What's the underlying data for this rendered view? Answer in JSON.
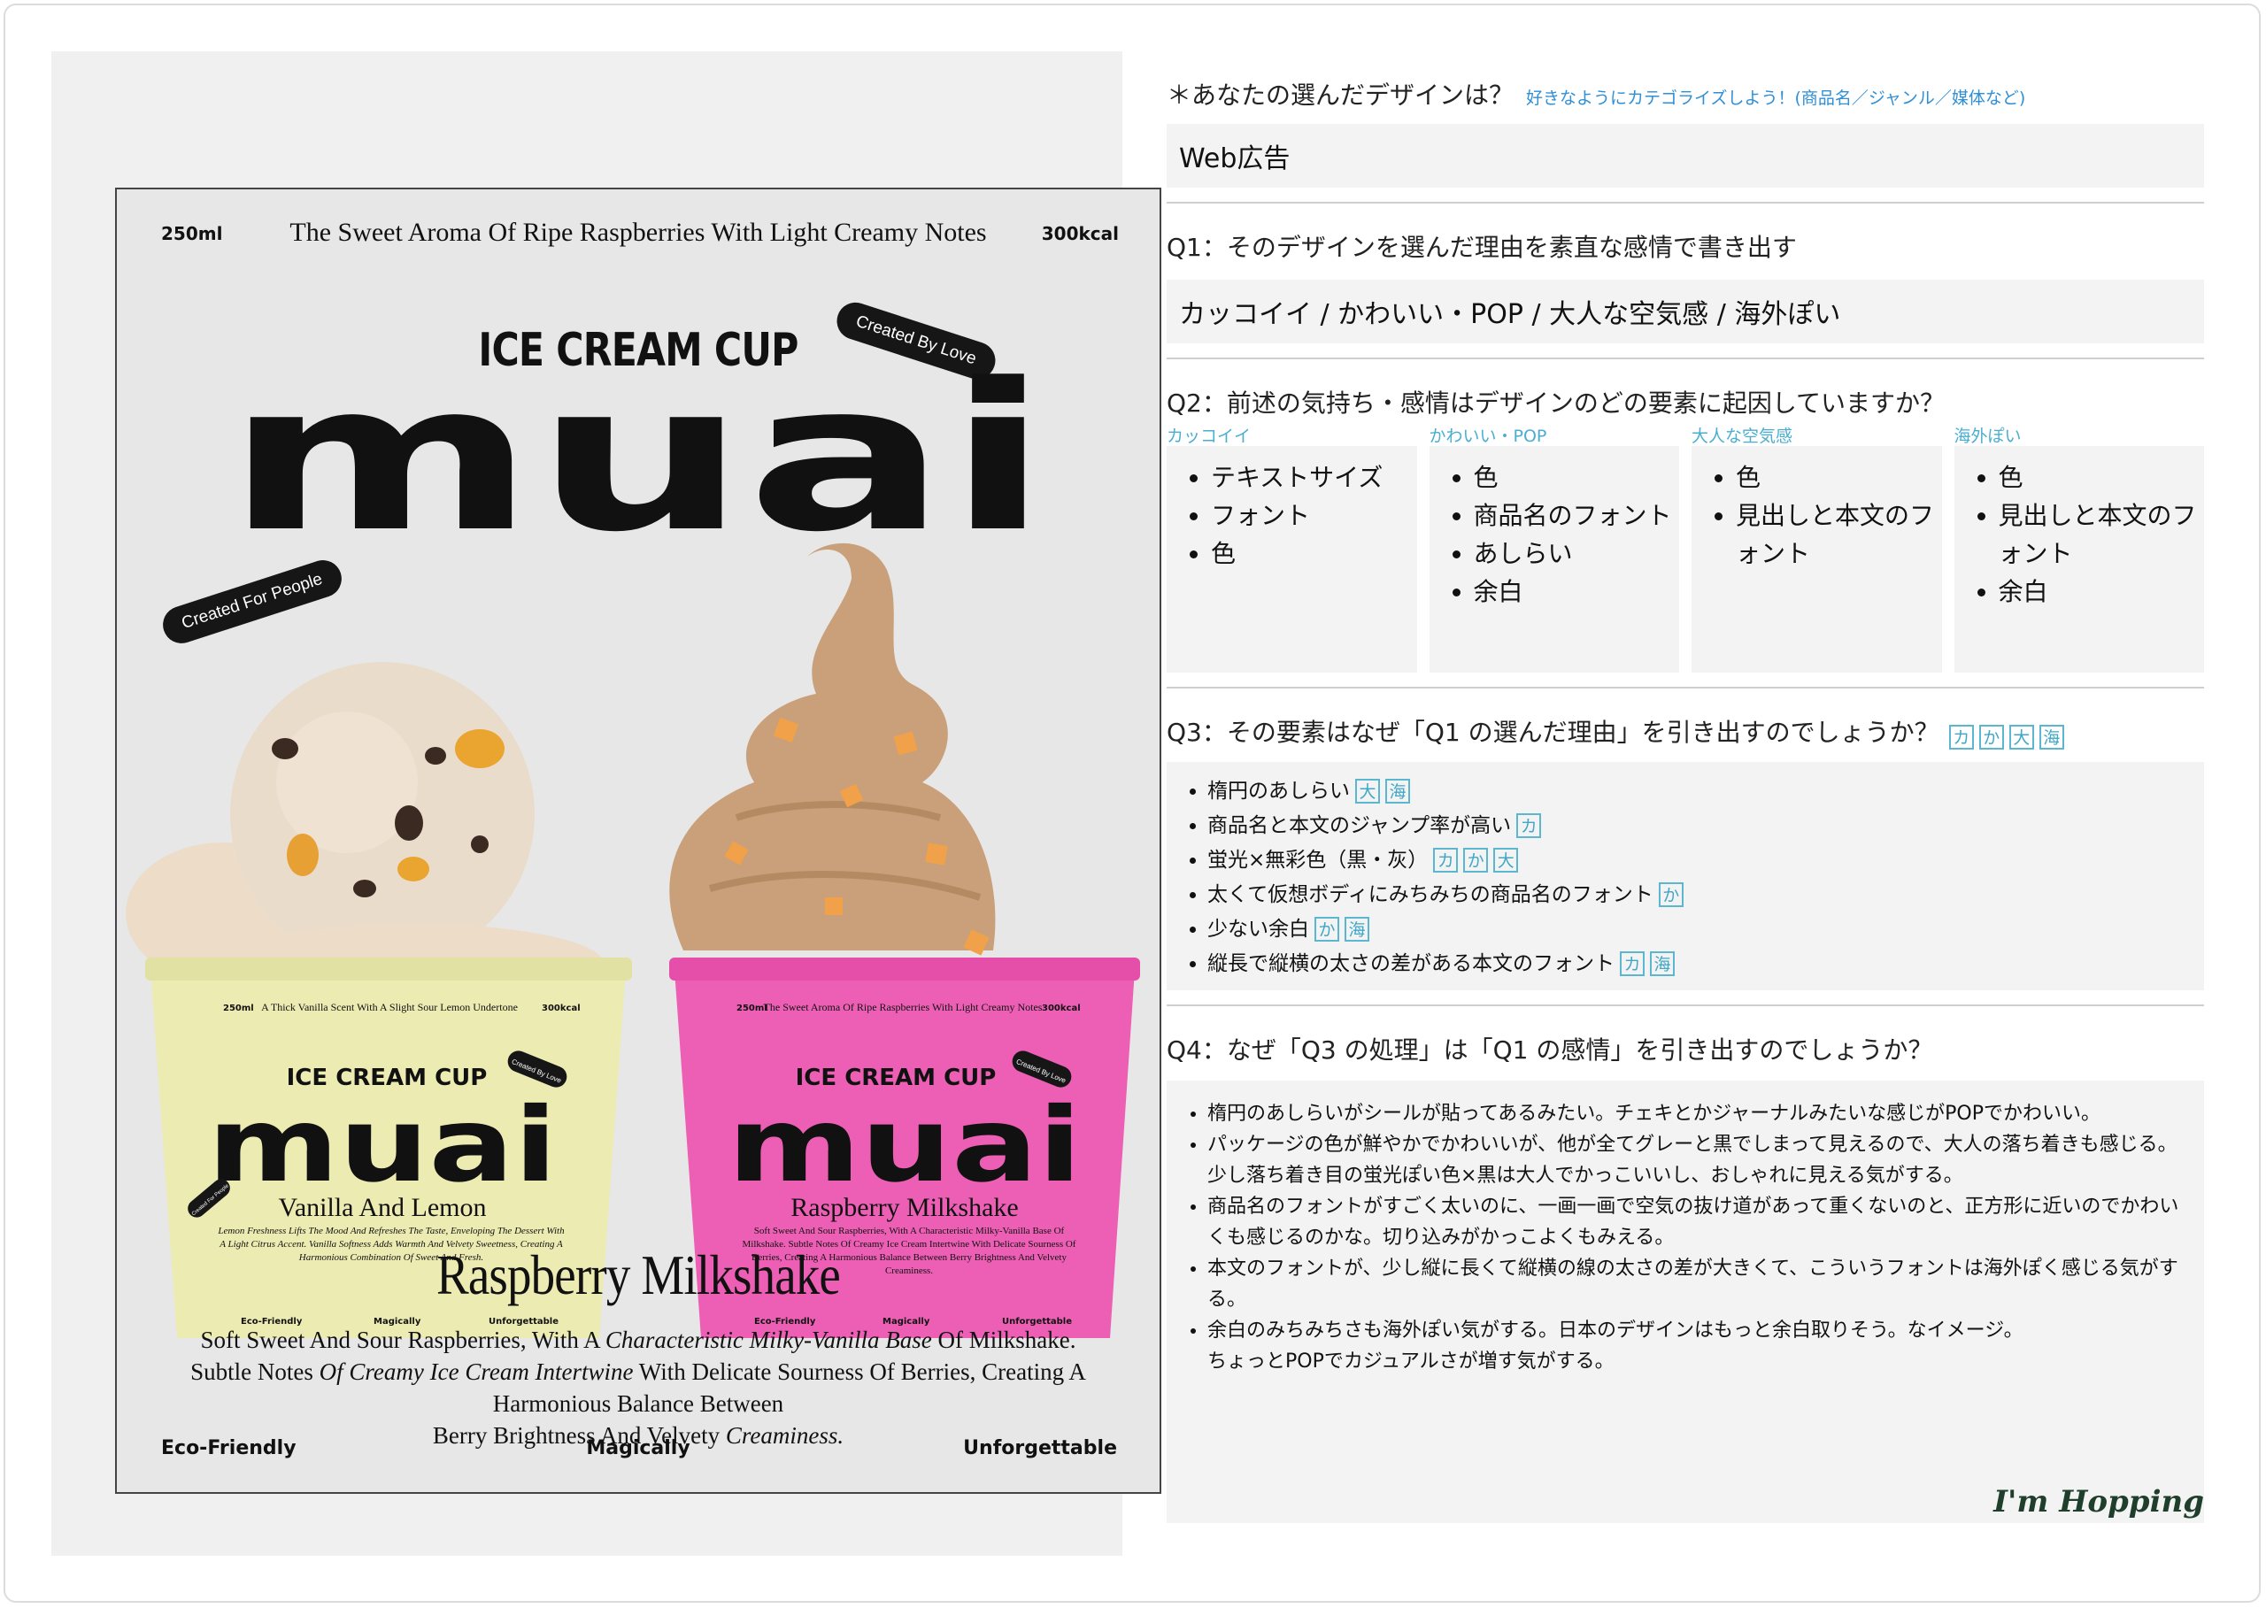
{
  "poster": {
    "volume": "250ml",
    "tagline": "The Sweet Aroma Of Ripe Raspberries With Light Creamy Notes",
    "calories": "300kcal",
    "cup_heading": "ICE CREAM CUP",
    "brand": "muai",
    "pill_love": "Created By Love",
    "pill_people": "Created For People",
    "cup_left": {
      "volume": "250ml",
      "tagline": "A Thick Vanilla Scent With A Slight Sour Lemon Undertone",
      "calories": "300kcal",
      "heading": "ICE CREAM CUP",
      "brand": "muai",
      "sticker": "Created By Love",
      "side_sticker": "Created For People",
      "flavor": "Vanilla And Lemon",
      "desc": "Lemon Freshness Lifts The Mood And Refreshes The Taste, Enveloping The Dessert With A Light Citrus Accent. Vanilla Softness Adds Warmth And Velvety Sweetness, Creating A Harmonious Combination Of Sweet And Fresh.",
      "foot": [
        "Eco-Friendly",
        "Magically",
        "Unforgettable"
      ]
    },
    "cup_right": {
      "volume": "250ml",
      "tagline": "The Sweet Aroma Of Ripe Raspberries With Light Creamy Notes",
      "calories": "300kcal",
      "heading": "ICE CREAM CUP",
      "brand": "muai",
      "sticker": "Created By Love",
      "flavor": "Raspberry Milkshake",
      "desc": "Soft Sweet And Sour Raspberries, With A Characteristic Milky-Vanilla Base Of Milkshake. Subtle Notes Of Creamy Ice Cream Intertwine With Delicate Sourness Of Berries, Creating A Harmonious Balance Between Berry Brightness And Velvety Creaminess.",
      "foot": [
        "Eco-Friendly",
        "Magically",
        "Unforgettable"
      ]
    },
    "product_title": "Raspberry Milkshake",
    "desc_line1_a": "Soft Sweet And Sour Raspberries, With A ",
    "desc_line1_b": "Characteristic Milky-Vanilla Base",
    "desc_line1_c": " Of Milkshake.",
    "desc_line2_a": "Subtle Notes ",
    "desc_line2_b": "Of Creamy Ice Cream Intertwine",
    "desc_line2_c": " With Delicate Sourness Of Berries, Creating A Harmonious Balance Between",
    "desc_line3_a": "Berry Brightness And Velvety ",
    "desc_line3_b": "Creaminess.",
    "bottom_left": "Eco-Friendly",
    "bottom_center": "Magically",
    "bottom_right": "Unforgettable"
  },
  "form": {
    "q0": {
      "label": "＊あなたの選んだデザインは？",
      "hint": "好きなようにカテゴライズしよう！(商品名／ジャンル／媒体など)",
      "answer": "Web広告"
    },
    "q1": {
      "label": "Q1：そのデザインを選んだ理由を素直な感情で書き出す",
      "answer": "カッコイイ / かわいい・POP / 大人な空気感 / 海外ぽい"
    },
    "q2": {
      "label": "Q2：前述の気持ち・感情はデザインのどの要素に起因していますか？",
      "columns": [
        {
          "label": "カッコイイ",
          "items": [
            "テキストサイズ",
            "フォント",
            "色"
          ]
        },
        {
          "label": "かわいい・POP",
          "items": [
            "色",
            "商品名のフォント",
            "あしらい",
            "余白"
          ]
        },
        {
          "label": "大人な空気感",
          "items": [
            "色",
            "見出しと本文のフォント"
          ]
        },
        {
          "label": "海外ぽい",
          "items": [
            "色",
            "見出しと本文のフォント",
            "余白"
          ]
        }
      ]
    },
    "q3": {
      "label": "Q3：その要素はなぜ「Q1 の選んだ理由」を引き出すのでしょうか？",
      "legend": [
        "カ",
        "か",
        "大",
        "海"
      ],
      "items": [
        {
          "text": "楕円のあしらい",
          "tags": [
            "大",
            "海"
          ]
        },
        {
          "text": "商品名と本文のジャンプ率が高い",
          "tags": [
            "カ"
          ]
        },
        {
          "text": "蛍光×無彩色（黒・灰）",
          "tags": [
            "カ",
            "か",
            "大"
          ]
        },
        {
          "text": "太くて仮想ボディにみちみちの商品名のフォント",
          "tags": [
            "か"
          ]
        },
        {
          "text": "少ない余白",
          "tags": [
            "か",
            "海"
          ]
        },
        {
          "text": "縦長で縦横の太さの差がある本文のフォント",
          "tags": [
            "カ",
            "海"
          ]
        }
      ]
    },
    "q4": {
      "label": "Q4：なぜ「Q3 の処理」は「Q1 の感情」を引き出すのでしょうか？",
      "items": [
        "楕円のあしらいがシールが貼ってあるみたい。チェキとかジャーナルみたいな感じがPOPでかわいい。",
        "パッケージの色が鮮やかでかわいいが、他が全てグレーと黒でしまって見えるので、大人の落ち着きも感じる。少し落ち着き目の蛍光ぽい色×黒は大人でかっこいいし、おしゃれに見える気がする。",
        "商品名のフォントがすごく太いのに、一画一画で空気の抜け道があって重くないのと、正方形に近いのでかわいくも感じるのかな。切り込みがかっこよくもみえる。",
        "本文のフォントが、少し縦に長くて縦横の線の太さの差が大きくて、こういうフォントは海外ぽく感じる気がする。",
        "余白のみちみちさも海外ぽい気がする。日本のデザインはもっと余白取りそう。なイメージ。\nちょっとPOPでカジュアルさが増す気がする。"
      ]
    },
    "signature": "I'm Hopping"
  },
  "colors": {
    "yellow_cup": "#ecebb2",
    "pink_cup": "#ec5fb4",
    "tag_blue": "#4aaed1",
    "hint_blue": "#2f8fd6"
  }
}
